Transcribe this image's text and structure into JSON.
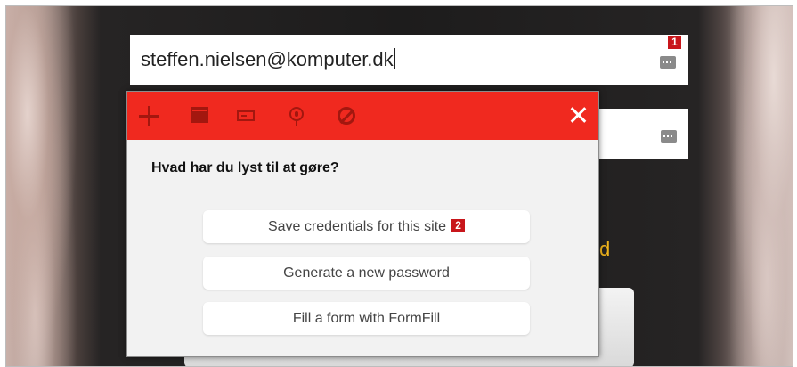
{
  "form": {
    "email_value": "steffen.nielsen@komputer.dk",
    "partial_link_text": "d"
  },
  "badges": {
    "first": "1",
    "second": "2"
  },
  "popup": {
    "question": "Hvad har du lyst til at gøre?",
    "actions": [
      "Save credentials for this site",
      "Generate a new password",
      "Fill a form with FormFill"
    ],
    "toolbar_icons": [
      "plus-icon",
      "site-icon",
      "card-icon",
      "pin-icon",
      "block-icon",
      "close-icon"
    ],
    "header_color": "#f0291f"
  }
}
